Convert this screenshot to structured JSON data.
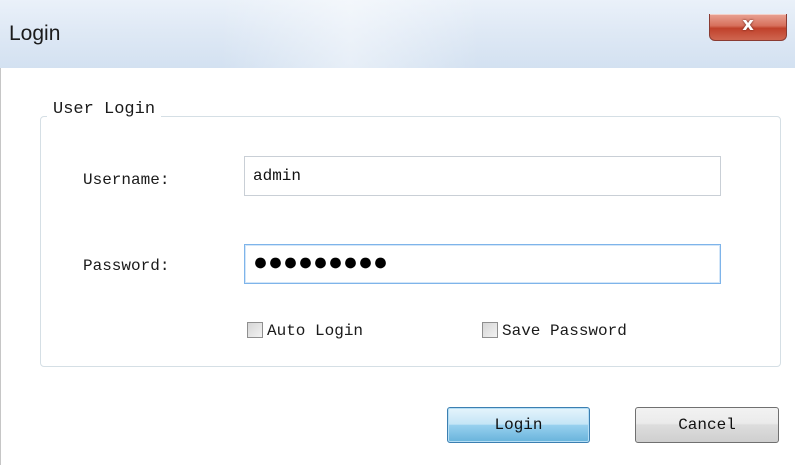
{
  "window": {
    "title": "Login",
    "close_glyph": "x"
  },
  "group": {
    "legend": "User Login"
  },
  "username": {
    "label": "Username:",
    "value": "admin"
  },
  "password": {
    "label": "Password:",
    "masked_value": "●●●●●●●●●",
    "length": 9
  },
  "options": {
    "auto_login": {
      "label": "Auto Login",
      "checked": false
    },
    "save_password": {
      "label": "Save Password",
      "checked": false
    }
  },
  "buttons": {
    "login": "Login",
    "cancel": "Cancel"
  },
  "colors": {
    "focus_border": "#7eb4ea",
    "default_button": "#98d1ef",
    "close_button": "#c0412b",
    "title_bar": "#dfe9f5"
  }
}
